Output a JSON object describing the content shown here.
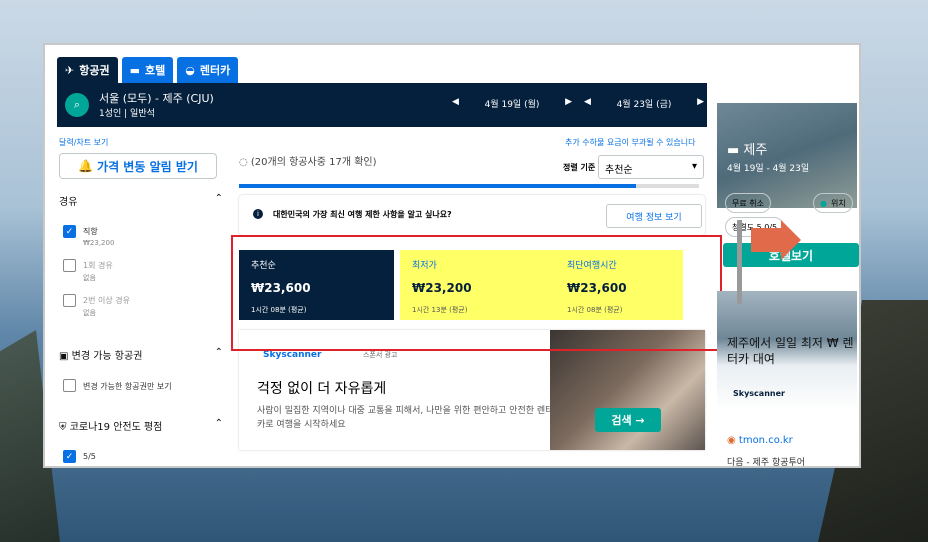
{
  "tabs": [
    {
      "label": "항공권",
      "icon": "plane-icon"
    },
    {
      "label": "호텔",
      "icon": "bed-icon"
    },
    {
      "label": "렌터카",
      "icon": "car-icon"
    }
  ],
  "search": {
    "route": "서울 (모두) - 제주 (CJU)",
    "passengers": "1성인 | 일반석",
    "depart": "4월 19일 (월)",
    "return": "4월 23일 (금)"
  },
  "links": {
    "calendar": "달력/차트 보기",
    "fees": "추가 수하물 요금이 부과될 수 있습니다"
  },
  "price_alert": "가격 변동 알림 받기",
  "filters": {
    "stops_title": "경유",
    "stops": [
      {
        "label": "직항",
        "price": "₩23,200",
        "checked": true
      },
      {
        "label": "1회 경유",
        "price": "없음",
        "checked": false
      },
      {
        "label": "2번 이상 경유",
        "price": "없음",
        "checked": false
      }
    ],
    "airports_title": "변경 가능 항공권",
    "airports_option": "변경 가능한 항공권만 보기",
    "covid_title": "코로나19 안전도 평점",
    "covid_option": "5/5"
  },
  "status": "(20개의 항공사중 17개 확인)",
  "sort": {
    "label": "정렬 기준",
    "value": "추천순"
  },
  "notice": {
    "text": "대한민국의 가장 최신 여행 제한 사항을 알고 싶나요?",
    "button": "여행 정보 보기"
  },
  "sort_tabs": [
    {
      "label": "추천순",
      "price": "₩23,600",
      "sub": "1시간 08분 (평균)"
    },
    {
      "label": "최저가",
      "price": "₩23,200",
      "sub": "1시간 13분 (평균)"
    },
    {
      "label": "최단여행시간",
      "price": "₩23,600",
      "sub": "1시간 08분 (평균)"
    }
  ],
  "ad": {
    "brand": "Skyscanner",
    "tag": "스폰서 광고",
    "headline": "걱정 없이 더 자유롭게",
    "body": "사람이 밀집한 지역이나 대중 교통을 피해서, 나만을 위한 편안하고 안전한 렌터카로 여행을 시작하세요",
    "cta": "검색 →"
  },
  "sidebar": {
    "hotel_title": "제주",
    "hotel_dates": "4월 19일 - 4월 23일",
    "chips": [
      "무료 취소",
      "위치",
      "청결도 5.0/5"
    ],
    "hotel_button": "호텔보기",
    "car_ad": "제주에서 일일 최저 ₩ 렌터카 대여",
    "car_brand": "Skyscanner",
    "tmon": "tmon.co.kr",
    "tmon_sub": "다음 - 제주 항공투어"
  },
  "colors": {
    "navy": "#05203c",
    "blue": "#0770e3",
    "teal": "#00a698",
    "highlight": "#ffff66",
    "red": "#e0212a"
  }
}
